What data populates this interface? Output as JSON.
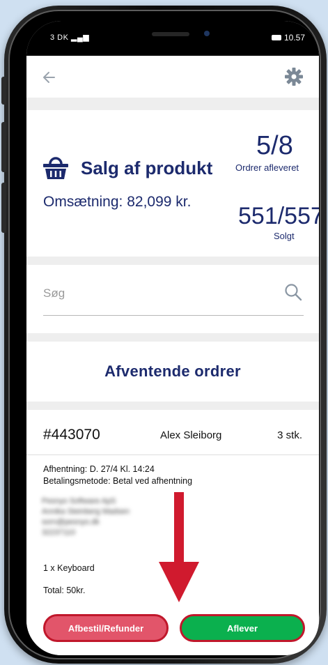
{
  "status_bar": {
    "carrier": "3 DK",
    "time": "10.57"
  },
  "header": {
    "back_icon": "arrow-left-icon",
    "settings_icon": "gear-icon"
  },
  "stats": {
    "product_title": "Salg af produkt",
    "revenue_label": "Omsætning:",
    "revenue_value": "82,099 kr.",
    "orders_delivered": "5/8",
    "orders_delivered_label": "Ordrer afleveret",
    "sold": "551/557",
    "sold_label": "Solgt"
  },
  "search": {
    "placeholder": "Søg"
  },
  "pending": {
    "title": "Afventende ordrer"
  },
  "order": {
    "number": "#443070",
    "customer": "Alex Sleiborg",
    "quantity": "3 stk.",
    "pickup": "Afhentning: D. 27/4 Kl. 14:24",
    "payment": "Betalingsmetode: Betal ved afhentning",
    "blurred_lines": [
      "Pesnyo Software ApS",
      "Annika Steinberg Madsen",
      "sorn@pesnyo.dk",
      "32237110"
    ],
    "item": "1 x Keyboard",
    "total": "Total: 50kr.",
    "cancel_label": "Afbestil/Refunder",
    "deliver_label": "Aflever"
  },
  "colors": {
    "brand_navy": "#1c2a6d",
    "cancel": "#e2556a",
    "deliver": "#0bb04e",
    "highlight": "#c0172b"
  }
}
